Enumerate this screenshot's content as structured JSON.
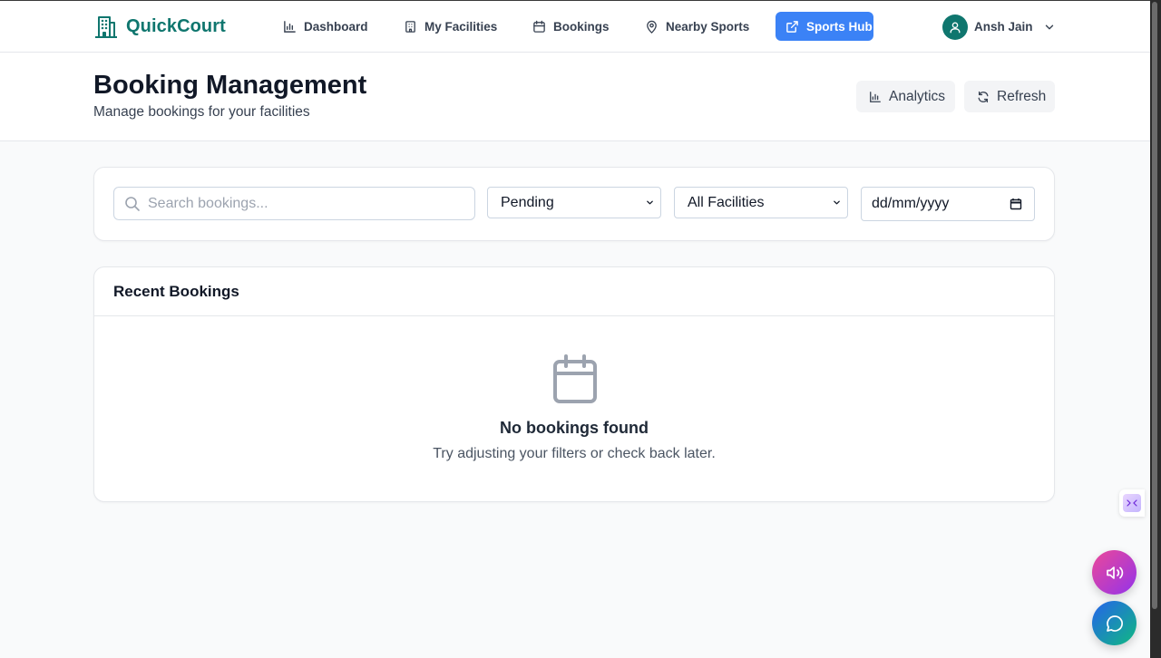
{
  "app": {
    "brand": "QuickCourt",
    "brand_color": "#0f766e",
    "accent_color": "#3b82f6"
  },
  "nav": {
    "items": [
      {
        "label": "Dashboard",
        "icon": "bar-chart-icon"
      },
      {
        "label": "My Facilities",
        "icon": "building-icon"
      },
      {
        "label": "Bookings",
        "icon": "calendar-icon"
      },
      {
        "label": "Nearby Sports",
        "icon": "map-pin-icon"
      },
      {
        "label": "Sports Hub",
        "icon": "external-link-icon",
        "highlighted": true
      }
    ],
    "user": {
      "name": "Ansh Jain",
      "icon": "user-icon"
    }
  },
  "header": {
    "title": "Booking Management",
    "subtitle": "Manage bookings for your facilities",
    "analytics_label": "Analytics",
    "refresh_label": "Refresh"
  },
  "filters": {
    "search_placeholder": "Search bookings...",
    "status_selected": "Pending",
    "facility_selected": "All Facilities",
    "date_placeholder": "dd/mm/yyyy"
  },
  "bookings": {
    "title": "Recent Bookings",
    "empty_title": "No bookings found",
    "empty_text": "Try adjusting your filters or check back later."
  },
  "widgets": {
    "audio_icon": "speaker-icon",
    "chat_icon": "chat-bubble-icon"
  }
}
